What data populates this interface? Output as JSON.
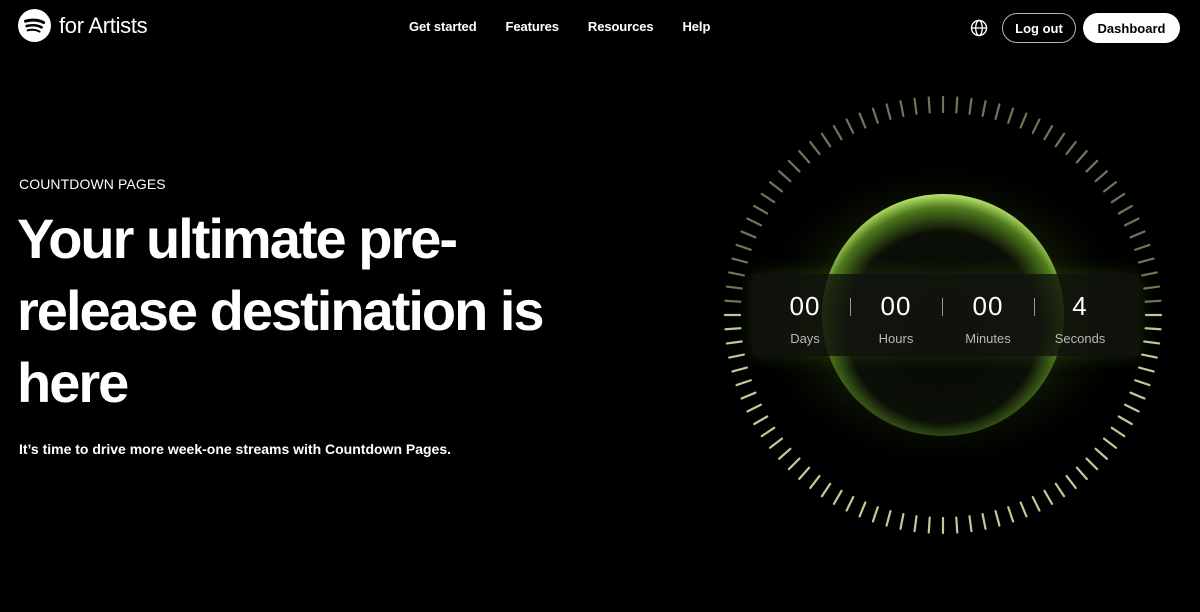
{
  "header": {
    "logo_text": "for Artists",
    "logo_icon": "spotify-logo",
    "nav": [
      "Get started",
      "Features",
      "Resources",
      "Help"
    ],
    "language_icon": "globe-icon",
    "logout_label": "Log out",
    "dashboard_label": "Dashboard"
  },
  "hero": {
    "eyebrow": "COUNTDOWN PAGES",
    "headline": "Your ultimate pre-release destination is here",
    "subtext": "It’s time to drive more week-one streams with Countdown Pages."
  },
  "countdown": {
    "units": [
      {
        "value": "00",
        "label": "Days"
      },
      {
        "value": "00",
        "label": "Hours"
      },
      {
        "value": "00",
        "label": "Minutes"
      },
      {
        "value": "4",
        "label": "Seconds"
      }
    ]
  },
  "colors": {
    "background": "#000000",
    "glow": "#9bd13a",
    "tick": "#c8d6a0"
  }
}
